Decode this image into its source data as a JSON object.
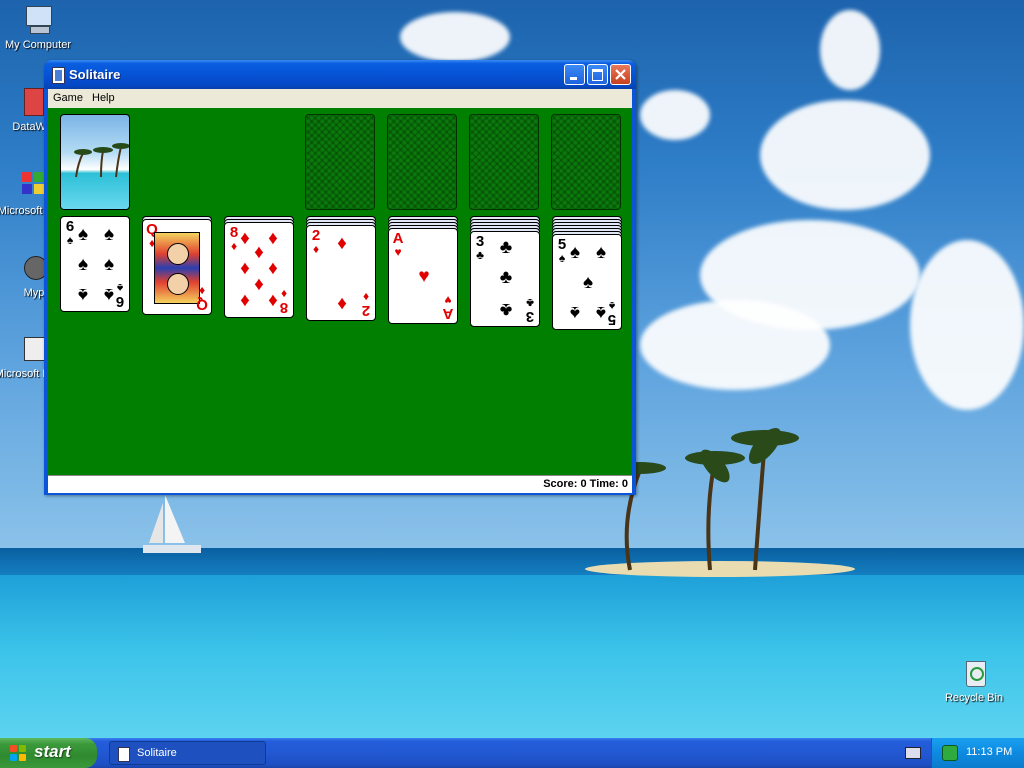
{
  "desktop": {
    "icons": [
      {
        "label": "My Computer"
      },
      {
        "label": "DataWa"
      },
      {
        "label": "Microsoft C++"
      },
      {
        "label": "Myp"
      },
      {
        "label": "Microsoft Basic"
      },
      {
        "label": "Recycle Bin"
      }
    ]
  },
  "window": {
    "title": "Solitaire",
    "menu": [
      "Game",
      "Help"
    ],
    "status": "Score: 0 Time: 0"
  },
  "game": {
    "stock": {
      "face_down": true
    },
    "foundations": [
      {
        "empty": true
      },
      {
        "empty": true
      },
      {
        "empty": true
      },
      {
        "empty": true
      }
    ],
    "tableau": [
      {
        "hidden": 0,
        "top": {
          "rank": "6",
          "suit": "♠",
          "color": "black"
        }
      },
      {
        "hidden": 1,
        "top": {
          "rank": "Q",
          "suit": "♦",
          "color": "red"
        }
      },
      {
        "hidden": 2,
        "top": {
          "rank": "8",
          "suit": "♦",
          "color": "red"
        }
      },
      {
        "hidden": 3,
        "top": {
          "rank": "2",
          "suit": "♦",
          "color": "red"
        }
      },
      {
        "hidden": 4,
        "top": {
          "rank": "A",
          "suit": "♥",
          "color": "red"
        }
      },
      {
        "hidden": 5,
        "top": {
          "rank": "3",
          "suit": "♣",
          "color": "black"
        }
      },
      {
        "hidden": 6,
        "top": {
          "rank": "5",
          "suit": "♠",
          "color": "black"
        }
      }
    ]
  },
  "taskbar": {
    "start_label": "start",
    "task_label": "Solitaire",
    "clock": "11:13 PM"
  },
  "colors": {
    "felt": "#007f00",
    "titlebar": "#0653d6",
    "taskbar": "#245edb",
    "start": "#3c9a3c",
    "red_suit": "#e00000"
  }
}
